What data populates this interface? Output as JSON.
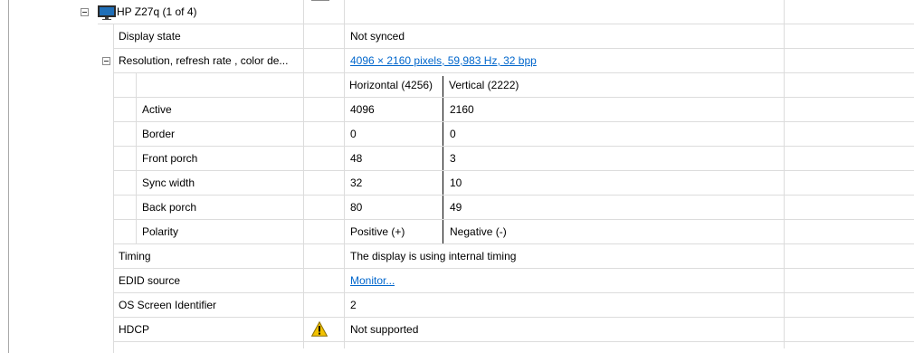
{
  "device": {
    "title": "HP Z27q (1 of 4)"
  },
  "rows": {
    "display_state": {
      "label": "Display state",
      "value": "Not synced"
    },
    "resolution": {
      "label": "Resolution, refresh rate , color de...",
      "value": "4096 × 2160 pixels, 59,983 Hz, 32 bpp"
    },
    "sub_header": {
      "horizontal": "Horizontal (4256)",
      "vertical": "Vertical (2222)"
    },
    "active": {
      "label": "Active",
      "h": "4096",
      "v": "2160"
    },
    "border": {
      "label": "Border",
      "h": "0",
      "v": "0"
    },
    "front_porch": {
      "label": "Front porch",
      "h": "48",
      "v": "3"
    },
    "sync_width": {
      "label": "Sync width",
      "h": "32",
      "v": "10"
    },
    "back_porch": {
      "label": "Back porch",
      "h": "80",
      "v": "49"
    },
    "polarity": {
      "label": "Polarity",
      "h": "Positive (+)",
      "v": "Negative (-)"
    },
    "timing": {
      "label": "Timing",
      "value": "The display is using internal timing"
    },
    "edid_source": {
      "label": "EDID source",
      "value": "Monitor..."
    },
    "os_screen_id": {
      "label": "OS Screen Identifier",
      "value": "2"
    },
    "hdcp": {
      "label": "HDCP",
      "value": "Not supported",
      "status_icon": "warning-icon"
    }
  },
  "colors": {
    "link": "#0066cc",
    "grid": "#dcdcdc",
    "warning": "#f2c200"
  }
}
